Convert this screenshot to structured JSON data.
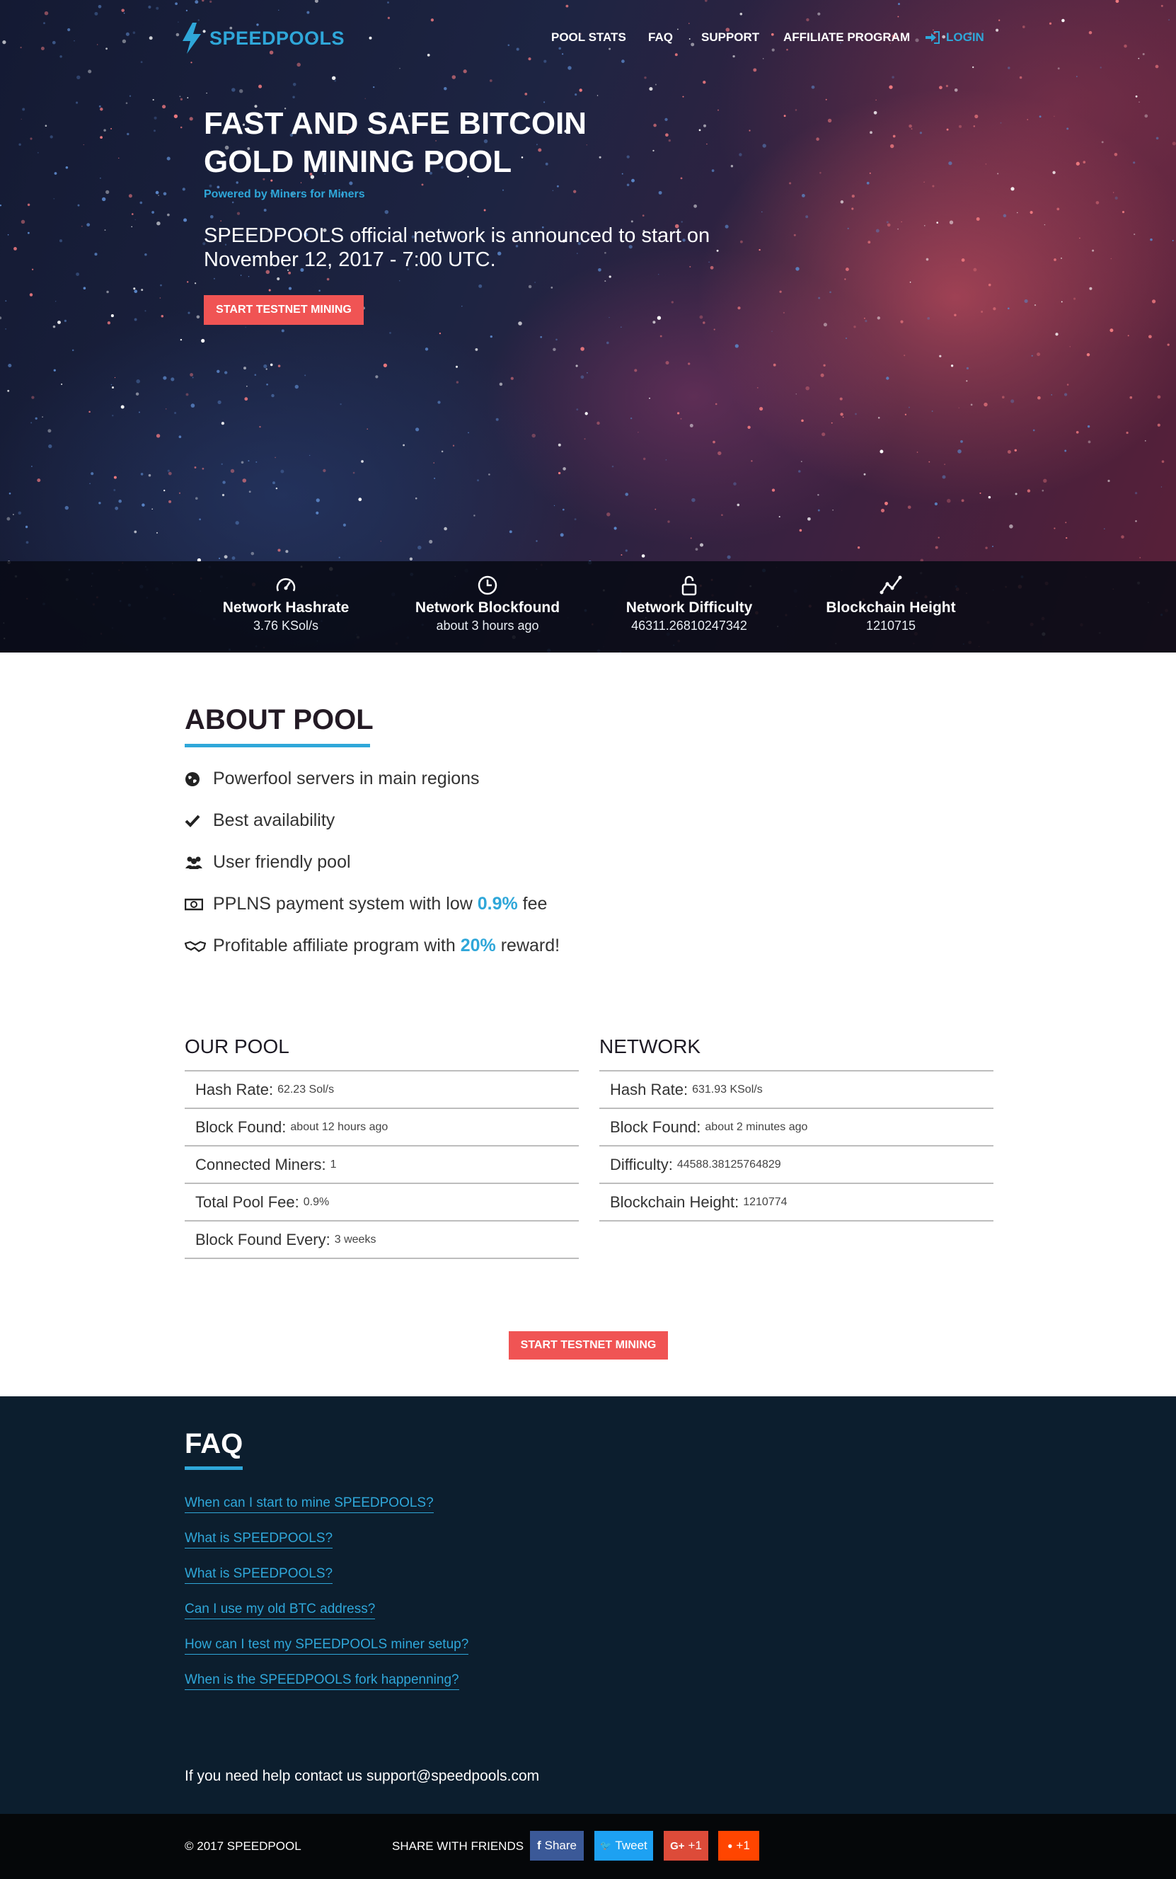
{
  "brand": {
    "name": "SPEEDPOOLS",
    "accent": "#2fa7d9",
    "cta": "#f05454"
  },
  "nav": {
    "items": [
      "POOL STATS",
      "FAQ",
      "SUPPORT",
      "AFFILIATE PROGRAM"
    ],
    "login": "LOGIN"
  },
  "hero": {
    "title": "FAST AND SAFE BITCOIN GOLD MINING POOL",
    "tagline": "Powered by Miners for Miners",
    "subtitle": "SPEEDPOOLS official network is announced to start on November 12, 2017 - 7:00 UTC.",
    "cta": "START TESTNET MINING"
  },
  "network_stats": [
    {
      "icon": "speedometer-icon",
      "label": "Network Hashrate",
      "value": "3.76 KSol/s"
    },
    {
      "icon": "clock-icon",
      "label": "Network Blockfound",
      "value": "about 3 hours ago"
    },
    {
      "icon": "unlock-icon",
      "label": "Network Difficulty",
      "value": "46311.26810247342"
    },
    {
      "icon": "graph-icon",
      "label": "Blockchain Height",
      "value": "1210715"
    }
  ],
  "about": {
    "title": "ABOUT POOL",
    "features": [
      {
        "icon": "globe-icon",
        "text": "Powerfool servers in main regions"
      },
      {
        "icon": "checkmark-icon",
        "text": "Best availability"
      },
      {
        "icon": "users-icon",
        "text": "User friendly pool"
      },
      {
        "icon": "money-icon",
        "pre": "PPLNS payment system with low ",
        "hl": "0.9%",
        "post": " fee"
      },
      {
        "icon": "handshake-icon",
        "pre": "Profitable affiliate program with ",
        "hl": "20%",
        "post": " reward!"
      }
    ]
  },
  "our_pool": {
    "title": "OUR POOL",
    "rows": [
      {
        "label": "Hash Rate:",
        "value": "62.23 Sol/s"
      },
      {
        "label": "Block Found:",
        "value": "about 12 hours ago"
      },
      {
        "label": "Connected Miners:",
        "value": "1"
      },
      {
        "label": "Total Pool Fee:",
        "value": "0.9%"
      },
      {
        "label": "Block Found Every:",
        "value": "3 weeks"
      }
    ]
  },
  "network": {
    "title": "NETWORK",
    "rows": [
      {
        "label": "Hash Rate:",
        "value": "631.93 KSol/s"
      },
      {
        "label": "Block Found:",
        "value": "about 2 minutes ago"
      },
      {
        "label": "Difficulty:",
        "value": "44588.38125764829"
      },
      {
        "label": "Blockchain Height:",
        "value": "1210774"
      }
    ]
  },
  "cta2": "START TESTNET MINING",
  "faq": {
    "title": "FAQ",
    "links": [
      "When can I start to mine SPEEDPOOLS?",
      "What is SPEEDPOOLS?",
      "What is SPEEDPOOLS?",
      "Can I use my old BTC address?",
      "How can I test my SPEEDPOOLS miner setup?",
      "When is the SPEEDPOOLS fork happenning?"
    ],
    "help": "If you need help contact us support@speedpools.com"
  },
  "footer": {
    "copyright": "© 2017 SPEEDPOOL",
    "share_label": "SHARE WITH FRIENDS",
    "buttons": [
      {
        "icon": "facebook-icon",
        "glyph": "f",
        "label": "Share",
        "color": "#3b5998"
      },
      {
        "icon": "twitter-icon",
        "glyph": "🐦",
        "label": "Tweet",
        "color": "#1da1f2"
      },
      {
        "icon": "google-plus-icon",
        "glyph": "G+",
        "label": "+1",
        "color": "#dd4b39"
      },
      {
        "icon": "reddit-icon",
        "glyph": "●",
        "label": "+1",
        "color": "#ff4500"
      }
    ]
  }
}
